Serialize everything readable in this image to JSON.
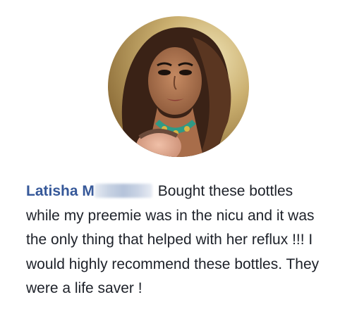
{
  "review": {
    "reviewer_name": "Latisha M",
    "text": "Bought these bottles while my preemie was in the nicu and it was the only thing that helped with her reflux !!! I would highly recommend these bottles. They were a life saver !"
  },
  "colors": {
    "name": "#365899",
    "text": "#1d2129",
    "background": "#ffffff"
  }
}
